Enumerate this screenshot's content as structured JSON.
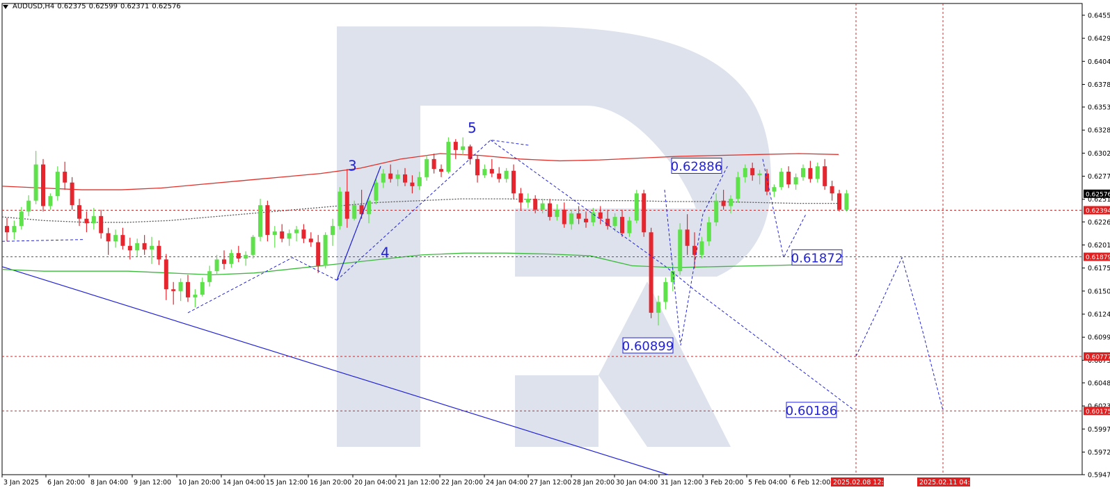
{
  "header": {
    "symbol": "AUDUSD,H4",
    "open": "0.62375",
    "high": "0.62599",
    "low": "0.62371",
    "close": "0.62576"
  },
  "colors": {
    "bull": "#5ee14a",
    "bear": "#e6262f",
    "ma_red": "#e0302a",
    "ma_green": "#3cb93c",
    "ma_dark": "#555555",
    "forecast": "#2323d6",
    "trend": "#2323d6",
    "hline": "#e02020",
    "logo": "#dde2ec",
    "grid_border": "#000000",
    "price_tag_current": "#000000",
    "price_tag_level": "#e02020"
  },
  "chart_data": {
    "type": "candlestick",
    "ylim": [
      0.5947,
      0.6468
    ],
    "y_ticks": [
      "0.64550",
      "0.64295",
      "0.64040",
      "0.63785",
      "0.63535",
      "0.63280",
      "0.63025",
      "0.62770",
      "0.62515",
      "0.62265",
      "0.62010",
      "0.61755",
      "0.61500",
      "0.61245",
      "0.60990",
      "0.60735",
      "0.60485",
      "0.60230",
      "0.59975",
      "0.59720",
      "0.59470"
    ],
    "x_labels": [
      "3 Jan 2025",
      "6 Jan 20:00",
      "8 Jan 04:00",
      "9 Jan 12:00",
      "10 Jan 20:00",
      "14 Jan 04:00",
      "15 Jan 12:00",
      "16 Jan 20:00",
      "20 Jan 04:00",
      "21 Jan 12:00",
      "22 Jan 20:00",
      "24 Jan 04:00",
      "27 Jan 12:00",
      "28 Jan 20:00",
      "30 Jan 04:00",
      "31 Jan 12:00",
      "3 Feb 20:00",
      "5 Feb 04:00",
      "6 Feb 12:00"
    ],
    "x_labels_highlight": [
      "2025.02.08 12:00",
      "2025.02.11 04:00"
    ],
    "price_tags": [
      {
        "text": "0.62576",
        "style": "current"
      },
      {
        "text": "0.62394",
        "style": "level"
      },
      {
        "text": "0.61879",
        "style": "level"
      },
      {
        "text": "0.60777",
        "style": "level"
      },
      {
        "text": "0.60175",
        "style": "level"
      }
    ],
    "horizontal_levels": [
      0.62394,
      0.61879,
      0.60777,
      0.60175
    ],
    "target_labels": [
      {
        "text": "0.62886",
        "value": 0.62886
      },
      {
        "text": "0.61872",
        "value": 0.61872
      },
      {
        "text": "0.60899",
        "value": 0.60899
      },
      {
        "text": "0.60186",
        "value": 0.60186
      }
    ],
    "wave_labels": [
      {
        "text": "3",
        "value": 0.6283
      },
      {
        "text": "4",
        "value": 0.6187
      },
      {
        "text": "5",
        "value": 0.6325
      }
    ],
    "candles_ohlc": [
      [
        0.6222,
        0.6231,
        0.6205,
        0.6215
      ],
      [
        0.6215,
        0.6228,
        0.6207,
        0.6222
      ],
      [
        0.6222,
        0.6243,
        0.6218,
        0.6238
      ],
      [
        0.6238,
        0.6256,
        0.6233,
        0.625
      ],
      [
        0.625,
        0.6305,
        0.6246,
        0.629
      ],
      [
        0.629,
        0.6296,
        0.6238,
        0.6244
      ],
      [
        0.6244,
        0.6258,
        0.624,
        0.6255
      ],
      [
        0.6255,
        0.6288,
        0.625,
        0.6282
      ],
      [
        0.6282,
        0.6293,
        0.6262,
        0.627
      ],
      [
        0.627,
        0.6276,
        0.624,
        0.6245
      ],
      [
        0.6245,
        0.6252,
        0.6222,
        0.623
      ],
      [
        0.623,
        0.6238,
        0.6215,
        0.6225
      ],
      [
        0.6225,
        0.6242,
        0.6218,
        0.6233
      ],
      [
        0.6233,
        0.624,
        0.6208,
        0.6214
      ],
      [
        0.6214,
        0.622,
        0.619,
        0.6205
      ],
      [
        0.6205,
        0.6218,
        0.6198,
        0.6212
      ],
      [
        0.6212,
        0.622,
        0.6196,
        0.62
      ],
      [
        0.62,
        0.6209,
        0.6185,
        0.6195
      ],
      [
        0.6195,
        0.6208,
        0.6188,
        0.6203
      ],
      [
        0.6203,
        0.6212,
        0.619,
        0.6196
      ],
      [
        0.6196,
        0.621,
        0.618,
        0.62
      ],
      [
        0.62,
        0.6206,
        0.6179,
        0.6185
      ],
      [
        0.6185,
        0.6191,
        0.614,
        0.6152
      ],
      [
        0.6152,
        0.616,
        0.6135,
        0.615
      ],
      [
        0.615,
        0.6164,
        0.6139,
        0.616
      ],
      [
        0.616,
        0.6168,
        0.6138,
        0.6143
      ],
      [
        0.6143,
        0.6152,
        0.6132,
        0.6146
      ],
      [
        0.6146,
        0.6165,
        0.6144,
        0.616
      ],
      [
        0.616,
        0.6178,
        0.6155,
        0.6172
      ],
      [
        0.6172,
        0.619,
        0.6168,
        0.6185
      ],
      [
        0.6185,
        0.6195,
        0.6174,
        0.618
      ],
      [
        0.618,
        0.6196,
        0.6176,
        0.6192
      ],
      [
        0.6192,
        0.62,
        0.6182,
        0.6186
      ],
      [
        0.6186,
        0.6194,
        0.6178,
        0.619
      ],
      [
        0.619,
        0.6212,
        0.6186,
        0.621
      ],
      [
        0.621,
        0.6252,
        0.6205,
        0.6245
      ],
      [
        0.6245,
        0.625,
        0.6205,
        0.6212
      ],
      [
        0.6212,
        0.6222,
        0.6198,
        0.6216
      ],
      [
        0.6216,
        0.6224,
        0.6204,
        0.6208
      ],
      [
        0.6208,
        0.6218,
        0.62,
        0.6214
      ],
      [
        0.6214,
        0.6222,
        0.6205,
        0.6218
      ],
      [
        0.6218,
        0.6224,
        0.6203,
        0.6208
      ],
      [
        0.6208,
        0.6215,
        0.6199,
        0.6204
      ],
      [
        0.6204,
        0.6212,
        0.617,
        0.6178
      ],
      [
        0.6178,
        0.6215,
        0.6175,
        0.6212
      ],
      [
        0.6212,
        0.623,
        0.62,
        0.6222
      ],
      [
        0.6222,
        0.6265,
        0.6218,
        0.626
      ],
      [
        0.626,
        0.6285,
        0.622,
        0.623
      ],
      [
        0.623,
        0.625,
        0.6228,
        0.6245
      ],
      [
        0.6245,
        0.6262,
        0.623,
        0.6235
      ],
      [
        0.6235,
        0.6255,
        0.6225,
        0.625
      ],
      [
        0.625,
        0.6275,
        0.6246,
        0.627
      ],
      [
        0.627,
        0.6285,
        0.6264,
        0.628
      ],
      [
        0.628,
        0.629,
        0.627,
        0.6274
      ],
      [
        0.6274,
        0.6284,
        0.6266,
        0.6279
      ],
      [
        0.6279,
        0.6286,
        0.6266,
        0.627
      ],
      [
        0.627,
        0.6278,
        0.6258,
        0.6266
      ],
      [
        0.6266,
        0.6282,
        0.6262,
        0.6276
      ],
      [
        0.6276,
        0.63,
        0.6272,
        0.6296
      ],
      [
        0.6296,
        0.6302,
        0.628,
        0.6285
      ],
      [
        0.6285,
        0.629,
        0.6276,
        0.6282
      ],
      [
        0.6282,
        0.632,
        0.628,
        0.6315
      ],
      [
        0.6315,
        0.6318,
        0.6296,
        0.6306
      ],
      [
        0.6306,
        0.632,
        0.63,
        0.631
      ],
      [
        0.631,
        0.6312,
        0.629,
        0.6296
      ],
      [
        0.6296,
        0.63,
        0.627,
        0.6278
      ],
      [
        0.6278,
        0.629,
        0.6275,
        0.6285
      ],
      [
        0.6285,
        0.6296,
        0.6276,
        0.628
      ],
      [
        0.628,
        0.6287,
        0.627,
        0.6274
      ],
      [
        0.6274,
        0.6286,
        0.627,
        0.6283
      ],
      [
        0.6283,
        0.629,
        0.6252,
        0.6258
      ],
      [
        0.6258,
        0.6264,
        0.624,
        0.6248
      ],
      [
        0.6248,
        0.6258,
        0.6242,
        0.6252
      ],
      [
        0.6252,
        0.6256,
        0.6236,
        0.624
      ],
      [
        0.624,
        0.6252,
        0.6236,
        0.6247
      ],
      [
        0.6247,
        0.6252,
        0.6228,
        0.6232
      ],
      [
        0.6232,
        0.6246,
        0.6228,
        0.624
      ],
      [
        0.624,
        0.6248,
        0.622,
        0.6224
      ],
      [
        0.6224,
        0.624,
        0.6218,
        0.6236
      ],
      [
        0.6236,
        0.6244,
        0.6224,
        0.623
      ],
      [
        0.623,
        0.6238,
        0.622,
        0.6226
      ],
      [
        0.6226,
        0.6242,
        0.6222,
        0.6237
      ],
      [
        0.6237,
        0.6244,
        0.6224,
        0.623
      ],
      [
        0.623,
        0.624,
        0.6218,
        0.6222
      ],
      [
        0.6222,
        0.6236,
        0.6216,
        0.6232
      ],
      [
        0.6232,
        0.624,
        0.621,
        0.6214
      ],
      [
        0.6214,
        0.6232,
        0.621,
        0.6228
      ],
      [
        0.6228,
        0.6262,
        0.6225,
        0.6258
      ],
      [
        0.6258,
        0.6262,
        0.621,
        0.6215
      ],
      [
        0.6215,
        0.622,
        0.612,
        0.6126
      ],
      [
        0.6126,
        0.6145,
        0.6112,
        0.6138
      ],
      [
        0.6138,
        0.6165,
        0.613,
        0.616
      ],
      [
        0.616,
        0.618,
        0.615,
        0.6172
      ],
      [
        0.6172,
        0.6225,
        0.6168,
        0.6218
      ],
      [
        0.6218,
        0.6235,
        0.619,
        0.62
      ],
      [
        0.62,
        0.6215,
        0.6175,
        0.619
      ],
      [
        0.619,
        0.621,
        0.6186,
        0.6205
      ],
      [
        0.6205,
        0.6232,
        0.62,
        0.6226
      ],
      [
        0.6226,
        0.6258,
        0.6222,
        0.625
      ],
      [
        0.625,
        0.6262,
        0.624,
        0.6244
      ],
      [
        0.6244,
        0.6256,
        0.6236,
        0.6252
      ],
      [
        0.6252,
        0.6282,
        0.6248,
        0.6276
      ],
      [
        0.6276,
        0.629,
        0.627,
        0.6286
      ],
      [
        0.6286,
        0.6292,
        0.6272,
        0.6278
      ],
      [
        0.6278,
        0.6284,
        0.6268,
        0.628
      ],
      [
        0.628,
        0.6285,
        0.6256,
        0.626
      ],
      [
        0.626,
        0.6268,
        0.6254,
        0.6265
      ],
      [
        0.6265,
        0.6286,
        0.6262,
        0.6282
      ],
      [
        0.6282,
        0.6288,
        0.6264,
        0.6268
      ],
      [
        0.6268,
        0.628,
        0.6262,
        0.6276
      ],
      [
        0.6276,
        0.629,
        0.6272,
        0.6286
      ],
      [
        0.6286,
        0.6294,
        0.627,
        0.6274
      ],
      [
        0.6274,
        0.6292,
        0.627,
        0.6288
      ],
      [
        0.6288,
        0.6296,
        0.6262,
        0.6266
      ],
      [
        0.6266,
        0.6272,
        0.625,
        0.6258
      ],
      [
        0.6258,
        0.6262,
        0.6238,
        0.624
      ],
      [
        0.624,
        0.6262,
        0.6238,
        0.6258
      ]
    ],
    "ma_red": [
      0.6266,
      0.6264,
      0.6262,
      0.6262,
      0.6264,
      0.6268,
      0.6272,
      0.6276,
      0.628,
      0.6286,
      0.6296,
      0.6302,
      0.63,
      0.6296,
      0.6294,
      0.6295,
      0.6297,
      0.6299,
      0.63,
      0.6301,
      0.6302,
      0.6301
    ],
    "ma_dark": [
      0.6232,
      0.6228,
      0.6226,
      0.6226,
      0.6228,
      0.6232,
      0.6236,
      0.624,
      0.6244,
      0.6248,
      0.625,
      0.6252,
      0.6252,
      0.6251,
      0.625,
      0.625,
      0.6249,
      0.6249,
      0.6248,
      0.6247,
      0.6247
    ],
    "ma_green": [
      0.6174,
      0.6172,
      0.6172,
      0.6172,
      0.617,
      0.6168,
      0.617,
      0.6175,
      0.618,
      0.6185,
      0.619,
      0.6192,
      0.6192,
      0.6191,
      0.6189,
      0.6178,
      0.6176,
      0.6177,
      0.6178,
      0.6179,
      0.618
    ],
    "trend_line": [
      [
        0,
        0.6177
      ],
      [
        1,
        0.5947
      ]
    ],
    "forecast_path": [
      0.6163,
      0.6223,
      0.6291,
      0.6246,
      0.6316,
      0.6196,
      0.6265,
      0.609,
      0.615,
      0.6289,
      0.626,
      0.6235,
      0.6188,
      0.6215,
      0.6237,
      0.6078,
      0.6187,
      0.6018
    ]
  }
}
